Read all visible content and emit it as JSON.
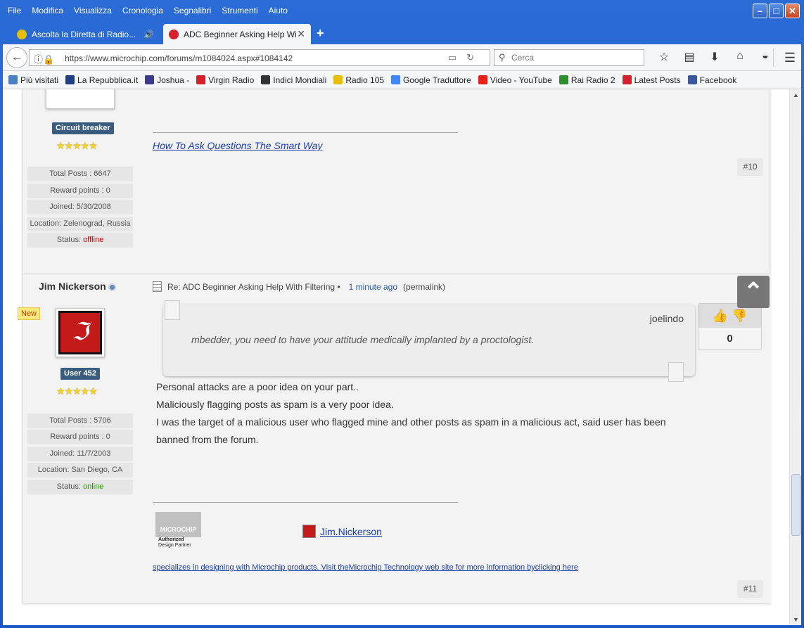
{
  "window": {
    "menu": [
      "File",
      "Modifica",
      "Visualizza",
      "Cronologia",
      "Segnalibri",
      "Strumenti",
      "Aiuto"
    ],
    "minimize": "–",
    "maximize": "□",
    "close": "✕"
  },
  "tabs": [
    {
      "title": "Ascolta la Diretta di Radio...",
      "icon": "radio105-icon",
      "audio": "🔊"
    },
    {
      "title": "ADC Beginner Asking Help Wit...",
      "icon": "microchip-icon",
      "close": "✕"
    }
  ],
  "newtab": "+",
  "toolbar": {
    "url": "https://www.microchip.com/forums/m1084024.aspx#1084142",
    "search_placeholder": "Cerca"
  },
  "bookmarks": [
    {
      "label": "Più visitati",
      "color": "#4a7fc4"
    },
    {
      "label": "La Repubblica.it",
      "color": "#1f3f80"
    },
    {
      "label": "Joshua -",
      "color": "#3b3b8a"
    },
    {
      "label": "Virgin Radio",
      "color": "#d4202a"
    },
    {
      "label": "Indici Mondiali",
      "color": "#333333"
    },
    {
      "label": "Radio 105",
      "color": "#e6c000"
    },
    {
      "label": "Google Traduttore",
      "color": "#4285f4"
    },
    {
      "label": "Video - YouTube",
      "color": "#e62117"
    },
    {
      "label": "Rai Radio 2",
      "color": "#2c8f2c"
    },
    {
      "label": "Latest Posts",
      "color": "#d4202a"
    },
    {
      "label": "Facebook",
      "color": "#3b5998"
    }
  ],
  "post1": {
    "rank": "Circuit breaker",
    "stars": "★★★★★",
    "stats": {
      "total_posts": "Total Posts : 6647",
      "reward_points": "Reward points : 0",
      "joined": "Joined: 5/30/2008",
      "location": "Location: Zelenograd, Russia",
      "status_label": "Status: ",
      "status_value": "offline"
    },
    "signature_link": "How To Ask Questions The Smart Way",
    "post_number": "#10"
  },
  "post2": {
    "username": "Jim Nickerson",
    "new_badge": "New",
    "rank": "User 452",
    "stars": "★★★★★",
    "stats": {
      "total_posts": "Total Posts : 5706",
      "reward_points": "Reward points : 0",
      "joined": "Joined: 11/7/2003",
      "location": "Location: San Diego, CA",
      "status_label": "Status: ",
      "status_value": "online"
    },
    "header": {
      "subject": "Re: ADC Beginner Asking Help With Filtering •",
      "time": "1 minute ago",
      "permalink": "(permalink)"
    },
    "quote": {
      "author": "joelindo",
      "text": "mbedder, you need to have your attitude medically implanted by a proctologist."
    },
    "vote_count": "0",
    "body": [
      "Personal attacks are a poor idea on your part..",
      "Maliciously flagging posts as spam is a very poor idea.",
      "I was the target of a malicious user who flagged mine and other posts as spam in a malicious act, said user has been banned from the forum."
    ],
    "logo": {
      "brand": "MICROCHIP",
      "line1": "Authorized",
      "line2": "Design Partner"
    },
    "signature_link": "Jim.Nickerson",
    "specialize_text": "specializes in designing with Microchip products. Visit theMicrochip Technology web site for more information byclicking here",
    "post_number": "#11"
  },
  "scroll_top": "⌃"
}
